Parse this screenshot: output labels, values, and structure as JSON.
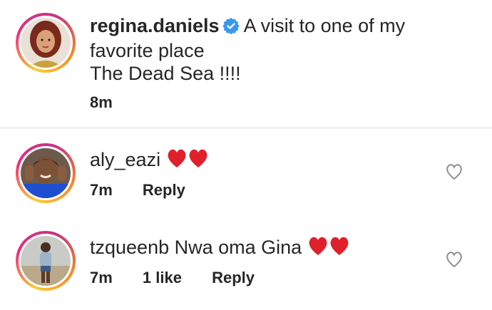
{
  "post": {
    "username": "regina.daniels",
    "caption_line1": "A visit to one of my",
    "caption_line2": "favorite place",
    "caption_line3": "The Dead Sea !!!!",
    "time": "8m"
  },
  "comments": [
    {
      "username": "aly_eazi",
      "emoji": "❤❤",
      "time": "7m",
      "reply_label": "Reply"
    },
    {
      "username": "tzqueenb",
      "text": "Nwa oma Gina",
      "emoji": "❤❤",
      "time": "7m",
      "likes": "1 like",
      "reply_label": "Reply"
    }
  ],
  "colors": {
    "verified": "#3897f0",
    "heart": "#e0202a",
    "divider": "#dbdbdb",
    "text": "#262626",
    "like_icon": "#8e8e8e"
  }
}
